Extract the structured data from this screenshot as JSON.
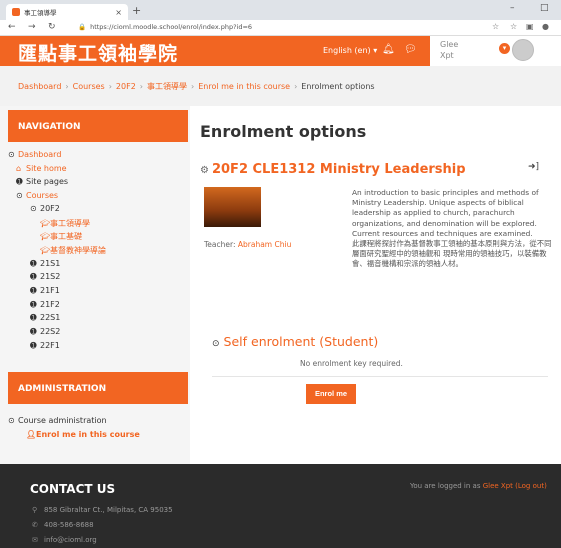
{
  "browser": {
    "tab_title": "事工領導學",
    "url": "https://cioml.moodle.school/enrol/index.php?id=6"
  },
  "header": {
    "site_name": "匯點事工領袖學院",
    "language": "English (en) ▾",
    "user_first": "Glee",
    "user_last": "Xpt"
  },
  "breadcrumb": [
    "Dashboard",
    "Courses",
    "20F2",
    "事工領導學",
    "Enrol me in this course",
    "Enrolment options"
  ],
  "navigation": {
    "title": "NAVIGATION",
    "items": [
      "Dashboard",
      "Site home",
      "Site pages",
      "Courses",
      "20F2",
      "事工領導學",
      "事工基礎",
      "基督教神學導論",
      "21S1",
      "21S2",
      "21F1",
      "21F2",
      "22S1",
      "22S2",
      "22F1"
    ]
  },
  "administration": {
    "title": "ADMINISTRATION",
    "items": [
      "Course administration",
      "Enrol me in this course"
    ]
  },
  "main": {
    "page_title": "Enrolment options",
    "course_title": "20F2 CLE1312 Ministry Leadership",
    "teacher_label": "Teacher:",
    "teacher_name": "Abraham Chiu",
    "summary_en": "An introduction to basic principles and methods of Ministry Leadership. Unique aspects of biblical leadership as applied to church, parachurch organizations, and denomination will be explored. Current resources and techniques are examined.",
    "summary_zh": "此課程將探討作為基督教事工領袖的基本原則與方法，從不同層面研究聖經中的領袖觀和 現時常用的領袖技巧，以裝備教會、福音機構和宗派的領袖人材。",
    "self_enrol_title": "Self enrolment (Student)",
    "no_key": "No enrolment key required.",
    "enrol_button": "Enrol me"
  },
  "footer": {
    "title": "CONTACT US",
    "address": "858 Gibraltar Ct., Milpitas, CA 95035",
    "phone": "408-586-8688",
    "email": "info@cioml.org",
    "logged_in_prefix": "You are logged in as",
    "logged_in_user": "Glee Xpt",
    "logout": "(Log out)"
  }
}
